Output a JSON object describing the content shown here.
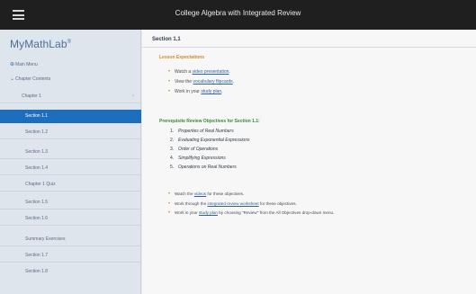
{
  "header": {
    "title": "College Algebra with Integrated Review"
  },
  "sidebar": {
    "logo": "MyMathLab",
    "logo_mark": "®",
    "items": [
      {
        "label": "Main Menu",
        "bullet": "⊕"
      },
      {
        "label": "Chapter Contents",
        "bullet": "⌄"
      },
      {
        "label": "Chapter 1"
      },
      {
        "label": "Section 1.1"
      },
      {
        "label": "Section 1.2"
      },
      {
        "label": "Section 1.3"
      },
      {
        "label": "Section 1.4"
      },
      {
        "label": "Chapter 1 Quiz"
      },
      {
        "label": "Section 1.5"
      },
      {
        "label": "Section 1.6"
      },
      {
        "label": "Summary Exercises"
      },
      {
        "label": "Section 1.7"
      },
      {
        "label": "Section 1.8"
      }
    ]
  },
  "main": {
    "section_title": "Section 1.1",
    "lesson_heading": "Lesson Expectations",
    "lesson_items": [
      {
        "before": "Watch a ",
        "link": "video presentation",
        "after": "."
      },
      {
        "before": "View the ",
        "link": "vocabulary flipcards",
        "after": "."
      },
      {
        "before": "Work in your ",
        "link": "study plan",
        "after": "."
      }
    ],
    "objectives_heading": "Prerequisite Review Objectives for Section 1.1:",
    "objectives": [
      {
        "num": "1.",
        "text": "Properties of Real Numbers"
      },
      {
        "num": "2.",
        "text": "Evaluating Exponential Expressions"
      },
      {
        "num": "3.",
        "text": "Order of Operations"
      },
      {
        "num": "4.",
        "text": "Simplifying Expressions"
      },
      {
        "num": "5.",
        "text": "Operations on Real Numbers"
      }
    ],
    "tasks": [
      {
        "before": "Watch the ",
        "link": "videos",
        "after": " for these objectives."
      },
      {
        "before": "Work through the ",
        "link": "integrated review worksheet",
        "after": " for these objectives."
      },
      {
        "before": "Work in your ",
        "link": "study plan",
        "after": " by choosing \"Review\" from the All Objectives drop-down menu."
      }
    ]
  }
}
